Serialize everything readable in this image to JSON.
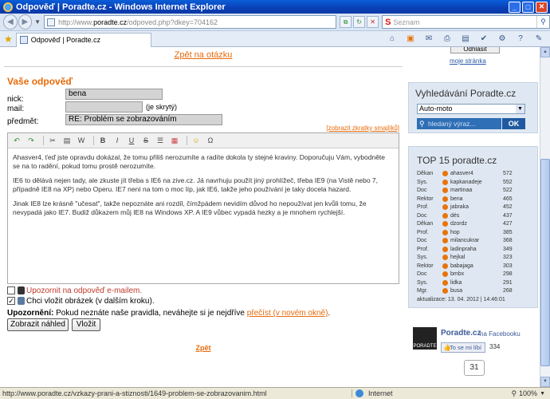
{
  "window": {
    "title": "Odpověď | Poradte.cz - Windows Internet Explorer"
  },
  "address": {
    "prefix": "http://www.",
    "domain": "poradte.cz",
    "path": "/odpoved.php?dkey=704162"
  },
  "search": {
    "provider_logo": "S",
    "placeholder": "Seznam"
  },
  "tab": {
    "label": "Odpověď | Poradte.cz"
  },
  "main": {
    "back_link": "Zpět na otázku",
    "section_title": "Vaše odpověď",
    "form": {
      "nick_label": "nick:",
      "nick_value": "bena",
      "mail_label": "mail:",
      "mail_value": "",
      "mail_note": "(je skrytý)",
      "subject_label": "předmět:",
      "subject_value": "RE: Problém se zobrazováním",
      "smileys_link": "[zobrazit zkratky smajlíků]"
    },
    "editor_text": [
      "Ahasver4, ťeď jste opravdu dokázal, že tomu přiliš nerozumíte a radíte dokola ty stejné kraviny. Doporučuju Vám, vybodněte se na to radění, pokud tomu prostě nerozumíte.",
      "IE6 to dělává nejen tady, ale zkuste jít třeba s IE6 na zive.cz. Já navrhuju použít jiný prohlížeč, třeba IE9 (na Vistě nebo 7, případně IE8 na XP) nebo Operu. IE7 není na tom o moc líp, jak IE6, takže jeho používání je taky docela hazard.",
      "Jinak IE8 lze krásně \"učesat\", takže nepoznáte ani rozdíl, čímžpádem nevidím důvod ho nepoužívat jen kvůli tomu, že nevypadá jako IE7. Budiž důkazem můj IE8 na Windows XP. A IE9 vůbec vypadá hezky a je mnohem rychlejší."
    ],
    "notify_label": "Upozornit na odpověď e-mailem.",
    "image_label": "Chci vložit obrázek (v dalším kroku).",
    "warning_lead": "Upozornění:",
    "warning_text": " Pokud neznáte naše pravidla, neváhejte si je nejdříve ",
    "warning_link": "přečíst (v novém okně)",
    "warning_end": ".",
    "preview_button": "Zobrazit náhled",
    "submit_button": "Vložit",
    "back_bottom": "Zpět"
  },
  "sidebar": {
    "account_button": "Odhlásit",
    "account_link": "moje stránka",
    "search_title": "Vyhledávání Poradte.cz",
    "search_category": "Auto-moto",
    "search_placeholder": "hledaný výraz...",
    "search_ok": "OK",
    "top_title": "TOP 15 poradte.cz",
    "top_rows": [
      {
        "rank": "Děkan",
        "name": "ahasver4",
        "points": "572"
      },
      {
        "rank": "Sys.",
        "name": "kapkanadeje",
        "points": "552"
      },
      {
        "rank": "Doc",
        "name": "martinaa",
        "points": "522"
      },
      {
        "rank": "Rektor",
        "name": "bena",
        "points": "465"
      },
      {
        "rank": "Prof.",
        "name": "jabraka",
        "points": "452"
      },
      {
        "rank": "Doc",
        "name": "dés",
        "points": "437"
      },
      {
        "rank": "Děkan",
        "name": "dzordz",
        "points": "427"
      },
      {
        "rank": "Prof.",
        "name": "hop",
        "points": "385"
      },
      {
        "rank": "Doc",
        "name": "milancukrar",
        "points": "368"
      },
      {
        "rank": "Prof.",
        "name": "ladinpraha",
        "points": "349"
      },
      {
        "rank": "Sys.",
        "name": "hejkal",
        "points": "323"
      },
      {
        "rank": "Rektor",
        "name": "babajaga",
        "points": "303"
      },
      {
        "rank": "Doc",
        "name": "bmbx",
        "points": "298"
      },
      {
        "rank": "Sys.",
        "name": "lidka",
        "points": "291"
      },
      {
        "rank": "Mgr.",
        "name": "busa",
        "points": "268"
      }
    ],
    "top_updated": "aktualizace: 13. 04. 2012 | 14:46:01",
    "fb_logo": "PORADTE",
    "fb_name": "Poradte.cz",
    "fb_sub": "na Facebooku",
    "fb_like": "To se mi líbí",
    "fb_count": "334",
    "share_count": "31"
  },
  "statusbar": {
    "url": "http://www.poradte.cz/vzkazy-prani-a-stiznosti/1649-problem-se-zobrazovanim.html",
    "zone": "Internet",
    "zoom": "100%"
  },
  "colors": {
    "accent": "#e86a0a",
    "titlebar": "#0a4fc6",
    "panel": "#dfe8f2"
  }
}
